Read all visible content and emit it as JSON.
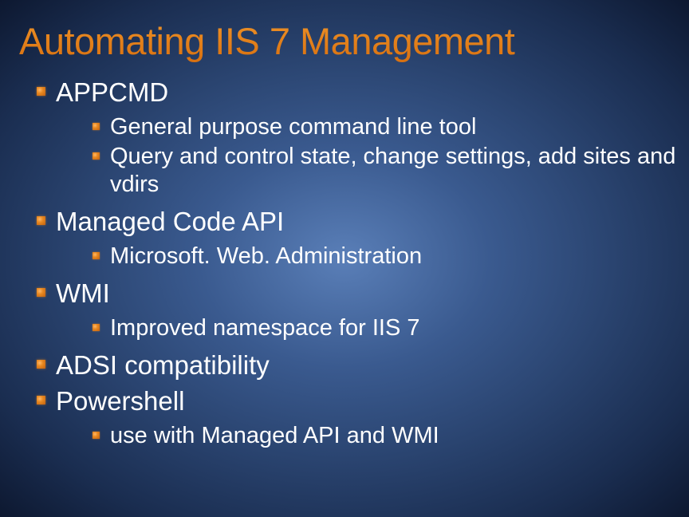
{
  "title": "Automating IIS 7 Management",
  "items": [
    {
      "label": "APPCMD",
      "children": [
        {
          "label": "General purpose command line tool"
        },
        {
          "label": "Query and control state, change settings, add sites and vdirs"
        }
      ]
    },
    {
      "label": "Managed Code API",
      "children": [
        {
          "label": "Microsoft. Web. Administration"
        }
      ]
    },
    {
      "label": "WMI",
      "children": [
        {
          "label": "Improved namespace for IIS 7"
        }
      ]
    },
    {
      "label": "ADSI compatibility",
      "children": []
    },
    {
      "label": "Powershell",
      "children": [
        {
          "label": "use with Managed API and WMI",
          "indent": true
        }
      ]
    }
  ]
}
